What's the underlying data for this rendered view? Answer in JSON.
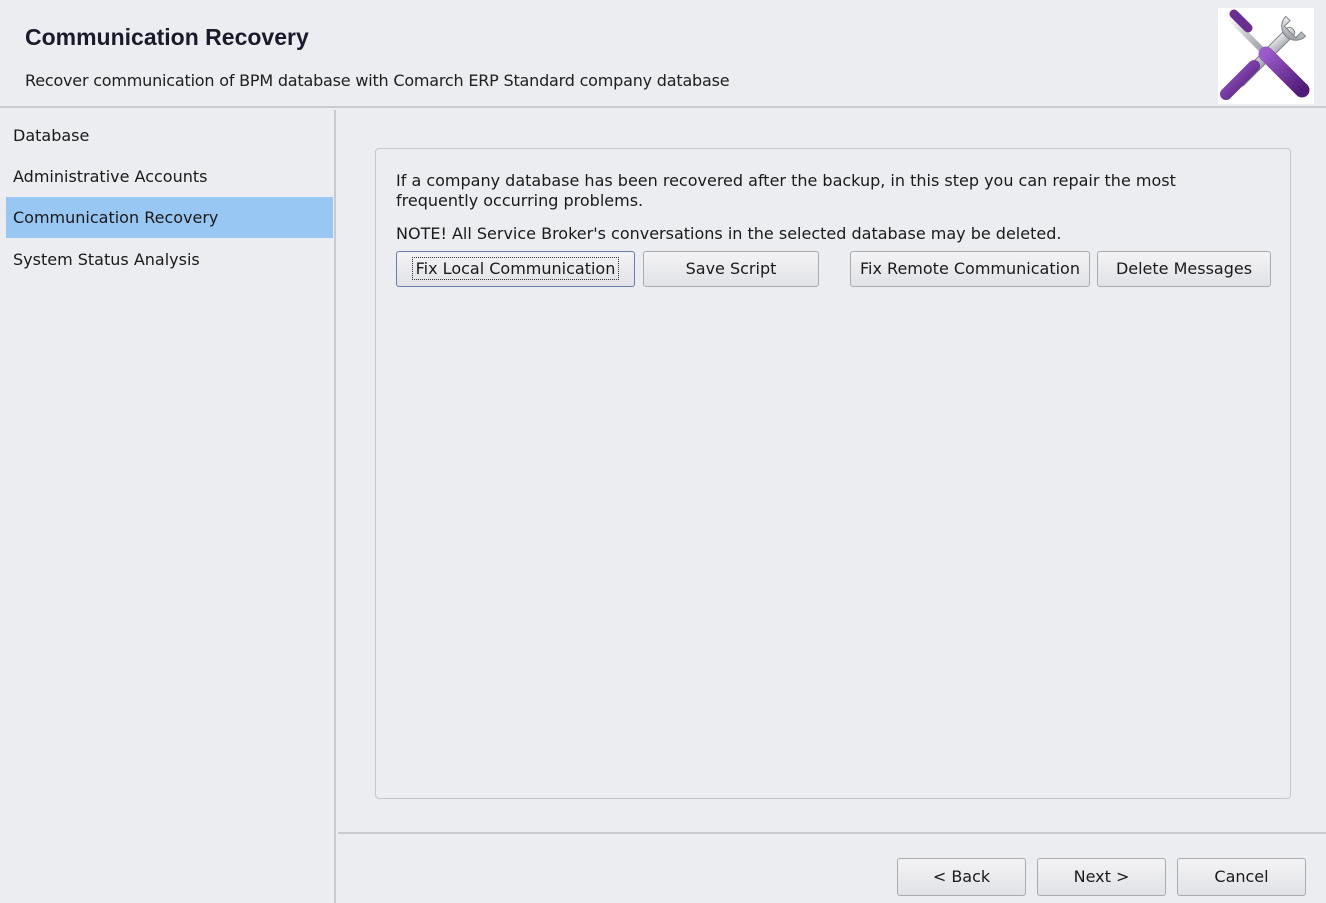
{
  "header": {
    "title": "Communication Recovery",
    "subtitle": "Recover communication of BPM database with Comarch ERP Standard company database",
    "icon": "tools-icon"
  },
  "sidebar": {
    "items": [
      {
        "label": "Database",
        "selected": false
      },
      {
        "label": "Administrative Accounts",
        "selected": false
      },
      {
        "label": "Communication Recovery",
        "selected": true
      },
      {
        "label": "System Status Analysis",
        "selected": false
      }
    ]
  },
  "main": {
    "description": "If a company database has been recovered after the backup, in this step you can repair the most frequently occurring problems.",
    "note": "NOTE! All Service Broker's conversations in the selected database may be deleted.",
    "buttons": {
      "fix_local": "Fix Local Communication",
      "save_script": "Save Script",
      "fix_remote": "Fix Remote Communication",
      "delete_messages": "Delete Messages"
    }
  },
  "footer": {
    "back": "< Back",
    "next": "Next >",
    "cancel": "Cancel"
  },
  "colors": {
    "background": "#ecedf1",
    "selection": "#99c7f3",
    "icon_handle": "#6a2d91"
  }
}
